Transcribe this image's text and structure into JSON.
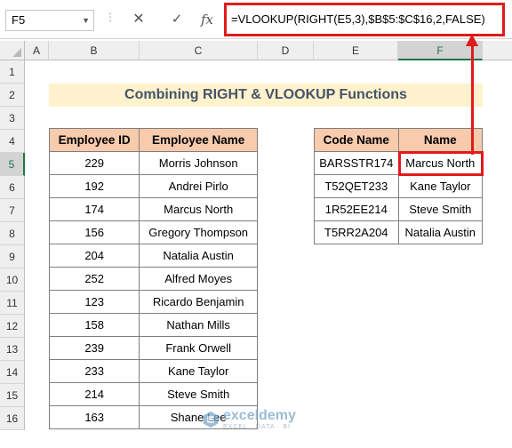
{
  "formula_bar": {
    "name_box": "F5",
    "dots": "⋮",
    "cancel_glyph": "✕",
    "enter_glyph": "✓",
    "fx_label": "fx",
    "formula": "=VLOOKUP(RIGHT(E5,3),$B$5:$C$16,2,FALSE)"
  },
  "columns": [
    "A",
    "B",
    "C",
    "D",
    "E",
    "F"
  ],
  "selected_column": "F",
  "rows": [
    "1",
    "2",
    "3",
    "4",
    "5",
    "6",
    "7",
    "8",
    "9",
    "10",
    "11",
    "12",
    "13",
    "14",
    "15",
    "16"
  ],
  "selected_row": "5",
  "title": "Combining RIGHT & VLOOKUP Functions",
  "table1": {
    "headers": [
      "Employee ID",
      "Employee Name"
    ],
    "rows": [
      [
        "229",
        "Morris Johnson"
      ],
      [
        "192",
        "Andrei Pirlo"
      ],
      [
        "174",
        "Marcus North"
      ],
      [
        "156",
        "Gregory Thompson"
      ],
      [
        "204",
        "Natalia Austin"
      ],
      [
        "252",
        "Alfred Moyes"
      ],
      [
        "123",
        "Ricardo Benjamin"
      ],
      [
        "158",
        "Nathan Mills"
      ],
      [
        "239",
        "Frank Orwell"
      ],
      [
        "233",
        "Kane Taylor"
      ],
      [
        "214",
        "Steve Smith"
      ],
      [
        "163",
        "Shane Lee"
      ]
    ]
  },
  "table2": {
    "headers": [
      "Code Name",
      "Name"
    ],
    "rows": [
      [
        "BARSSTR174",
        "Marcus North"
      ],
      [
        "T52QET233",
        "Kane Taylor"
      ],
      [
        "1R52EE214",
        "Steve Smith"
      ],
      [
        "T5RR2A204",
        "Natalia Austin"
      ]
    ]
  },
  "colors": {
    "accent_red": "#e01b1b",
    "header_fill": "#f8cbad",
    "title_fill": "#fff2cc",
    "title_text": "#44546a"
  },
  "watermark": {
    "brand": "exceldemy",
    "tagline": "EXCEL · DATA · BI"
  }
}
